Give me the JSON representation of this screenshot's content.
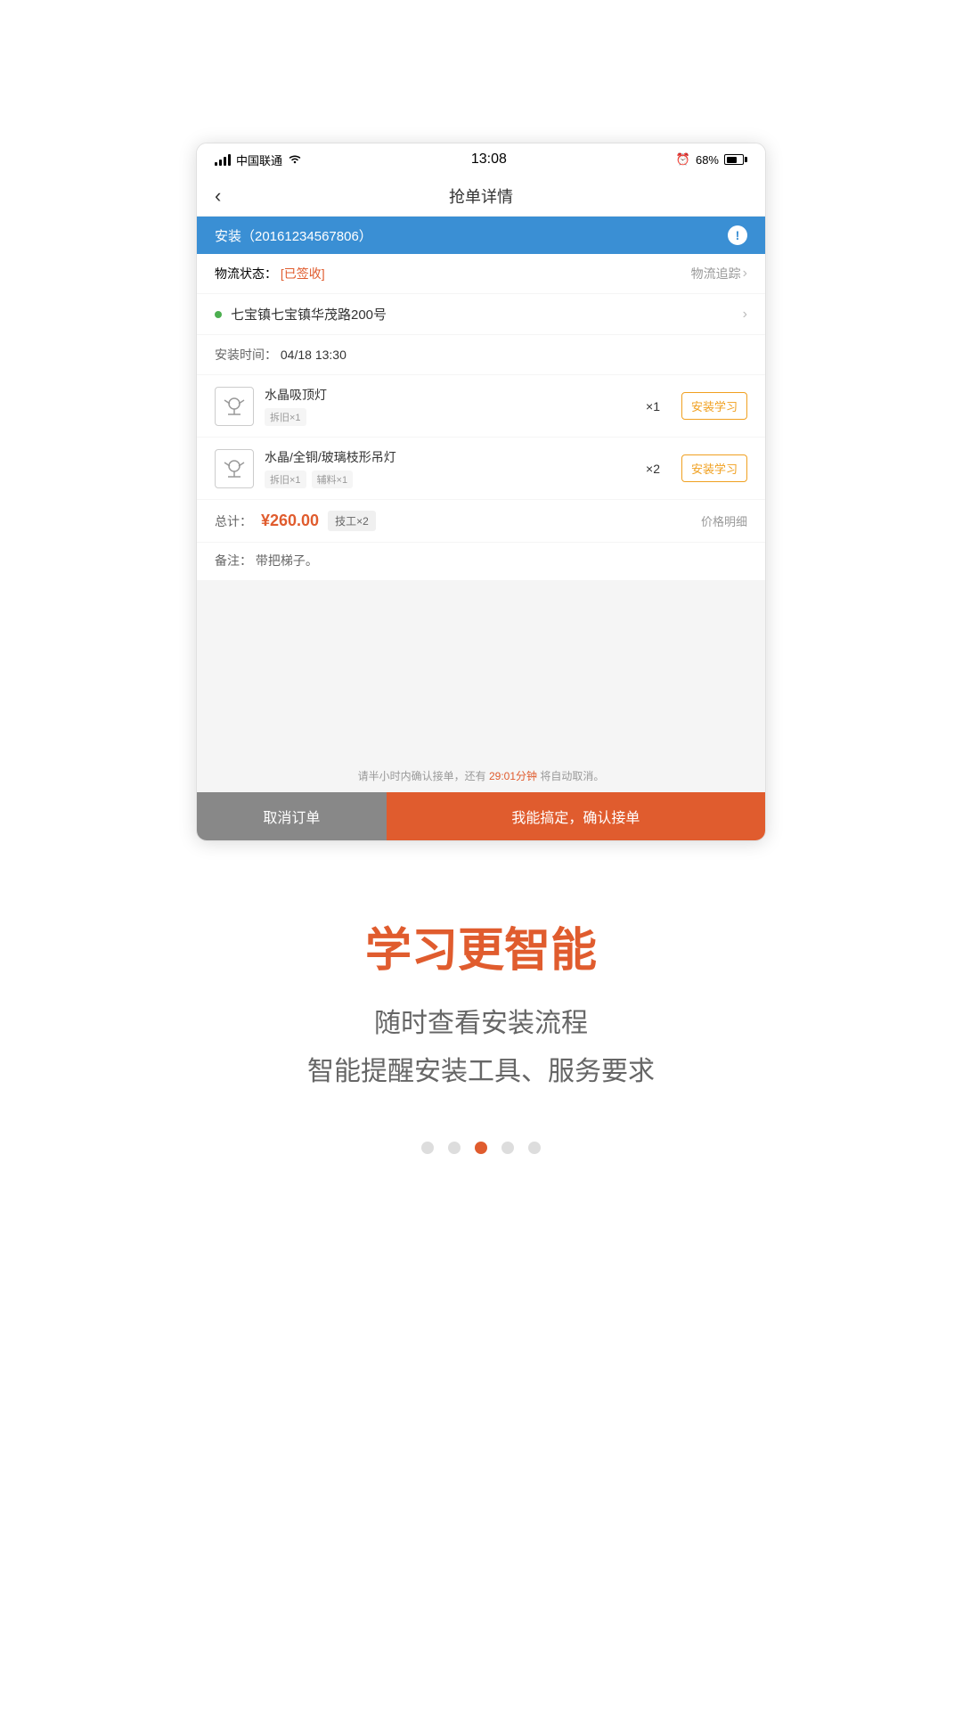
{
  "statusBar": {
    "carrier": "中国联通",
    "wifi": "wifi",
    "time": "13:08",
    "alarm": "alarm",
    "battery": "68%"
  },
  "navBar": {
    "backLabel": "‹",
    "title": "抢单详情"
  },
  "orderHeader": {
    "text": "安装（20161234567806）",
    "iconLabel": "!"
  },
  "logistics": {
    "label": "物流状态：",
    "status": "[已签收]",
    "trackLabel": "物流追踪",
    "trackArrow": "›"
  },
  "address": {
    "text": "七宝镇七宝镇华茂路200号"
  },
  "installTime": {
    "label": "安装时间：",
    "value": "04/18 13:30"
  },
  "products": [
    {
      "name": "水晶吸顶灯",
      "tags": [
        "拆旧×1"
      ],
      "qty": "×1",
      "learnLabel": "安装学习"
    },
    {
      "name": "水晶/全铜/玻璃枝形吊灯",
      "tags": [
        "拆旧×1",
        "辅料×1"
      ],
      "qty": "×2",
      "learnLabel": "安装学习"
    }
  ],
  "total": {
    "label": "总计：",
    "amount": "¥260.00",
    "techBadge": "技工×2",
    "detailLabel": "价格明细"
  },
  "note": {
    "label": "备注：",
    "text": "带把梯子。"
  },
  "bottomHint": {
    "prefix": "请半小时内确认接单，还有",
    "countdown": "29:01分钟",
    "suffix": "将自动取消。"
  },
  "buttons": {
    "cancel": "取消订单",
    "confirm": "我能搞定，确认接单"
  },
  "promo": {
    "title": "学习更智能",
    "sub1": "随时查看安装流程",
    "sub2": "智能提醒安装工具、服务要求"
  },
  "pagination": {
    "total": 5,
    "activeIndex": 2
  }
}
